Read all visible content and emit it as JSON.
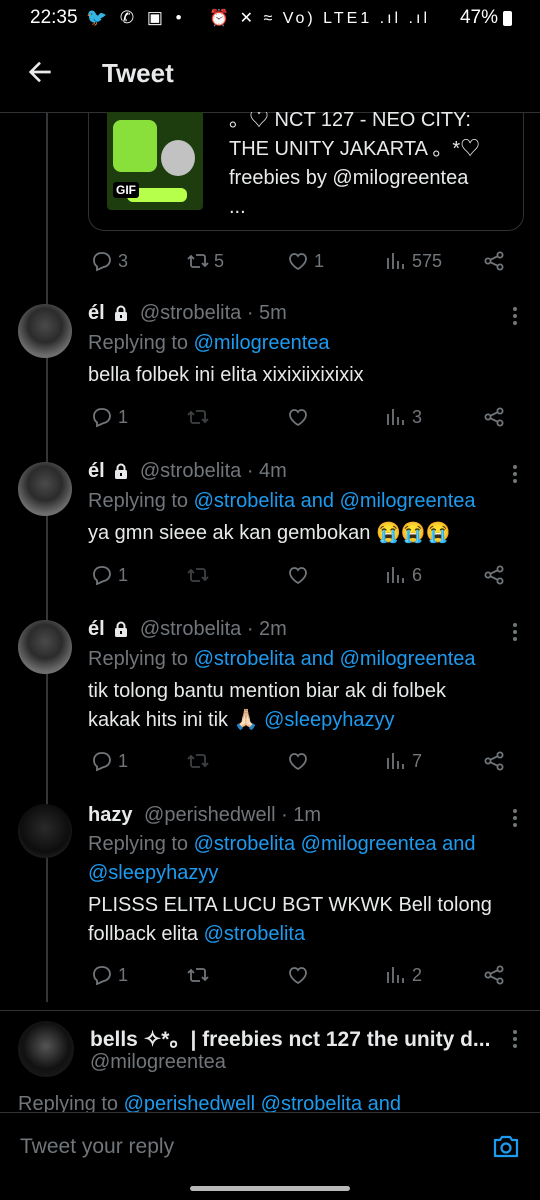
{
  "status": {
    "time": "22:35",
    "left_icons": "🐦 ✆ ▣ •",
    "right_icons": "⏰ ✕ ≈ Vo) LTE1 .ıl .ıl",
    "battery": "47%"
  },
  "header": {
    "title": "Tweet"
  },
  "quote": {
    "line1": "。♡ NCT 127 - NEO CITY:",
    "line2": "THE UNITY JAKARTA 。*♡",
    "line3": "freebies by @milogreentea",
    "line4": "...",
    "thumb_badge": "GIF"
  },
  "main_actions": {
    "replies": "3",
    "retweets": "5",
    "likes": "1",
    "views": "575"
  },
  "tweets": [
    {
      "name": "él",
      "handle": "@strobelita",
      "time": "· 5m",
      "replying_prefix": "Replying to ",
      "replying_targets": "@milogreentea",
      "body_lines": [
        "bella folbek ini elita xixixiixixixix"
      ],
      "actions": {
        "replies": "1",
        "retweets": "",
        "likes": "",
        "views": "3"
      }
    },
    {
      "name": "él",
      "handle": "@strobelita",
      "time": "· 4m",
      "replying_prefix": "Replying to ",
      "replying_targets": "@strobelita and @milogreentea",
      "body_lines": [
        "ya gmn sieee ak kan gembokan 😭😭😭"
      ],
      "actions": {
        "replies": "1",
        "retweets": "",
        "likes": "",
        "views": "6"
      }
    },
    {
      "name": "él",
      "handle": "@strobelita",
      "time": "· 2m",
      "replying_prefix": "Replying to ",
      "replying_targets": "@strobelita and @milogreentea",
      "body_lines": [
        "tik tolong bantu mention biar ak di folbek",
        "kakak hits ini tik 🙏🏻 "
      ],
      "body_mention": "@sleepyhazyy",
      "actions": {
        "replies": "1",
        "retweets": "",
        "likes": "",
        "views": "7"
      }
    },
    {
      "name": "hazy",
      "handle": "@perishedwell",
      "time": "· 1m",
      "replying_prefix": "Replying to ",
      "replying_targets": "@strobelita @milogreentea and",
      "replying_targets_2": "@sleepyhazyy",
      "body_lines": [
        "PLISSS ELITA LUCU BGT WKWK Bell tolong",
        "follback elita "
      ],
      "body_mention": "@strobelita",
      "actions": {
        "replies": "1",
        "retweets": "",
        "likes": "",
        "views": "2"
      }
    }
  ],
  "bells": {
    "name": "bells ✧*。| freebies nct 127 the unity d...",
    "handle": "@milogreentea",
    "replying_prefix": "Replying to ",
    "replying_targets": "@perishedwell @strobelita and"
  },
  "composer": {
    "placeholder": "Tweet your reply"
  },
  "colors": {
    "background": "#000000",
    "text": "#e7e9ea",
    "muted": "#71767b",
    "accent": "#1d9bf0"
  }
}
